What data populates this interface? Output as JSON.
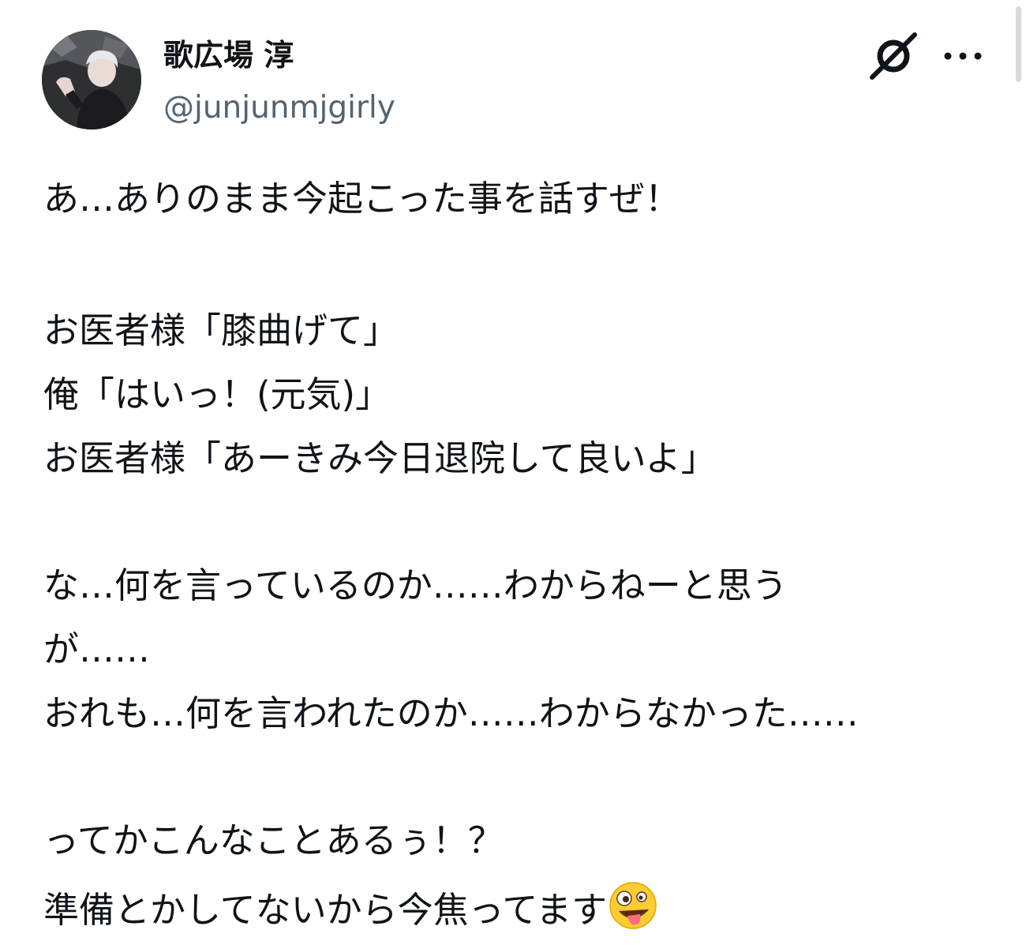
{
  "author": {
    "display_name": "歌広場 淳",
    "handle": "@junjunmjgirly"
  },
  "icons": {
    "avatar": "avatar-photo",
    "grok": "grok-icon",
    "more": "more-options-icon",
    "emoji": "zany-face-emoji"
  },
  "tweet": {
    "lines": [
      "あ…ありのまま今起こった事を話すぜ！",
      "",
      "お医者様「膝曲げて」",
      "俺「はいっ！(元気)」",
      "お医者様「あーきみ今日退院して良いよ」",
      "",
      "な…何を言っているのか……わからねーと思う",
      "が……",
      "おれも…何を言われたのか……わからなかった……",
      "",
      "ってかこんなことあるぅ！？",
      "準備とかしてないから今焦ってます"
    ]
  },
  "colors": {
    "text": "#0f1419",
    "secondary_text": "#536471",
    "background": "#ffffff"
  }
}
